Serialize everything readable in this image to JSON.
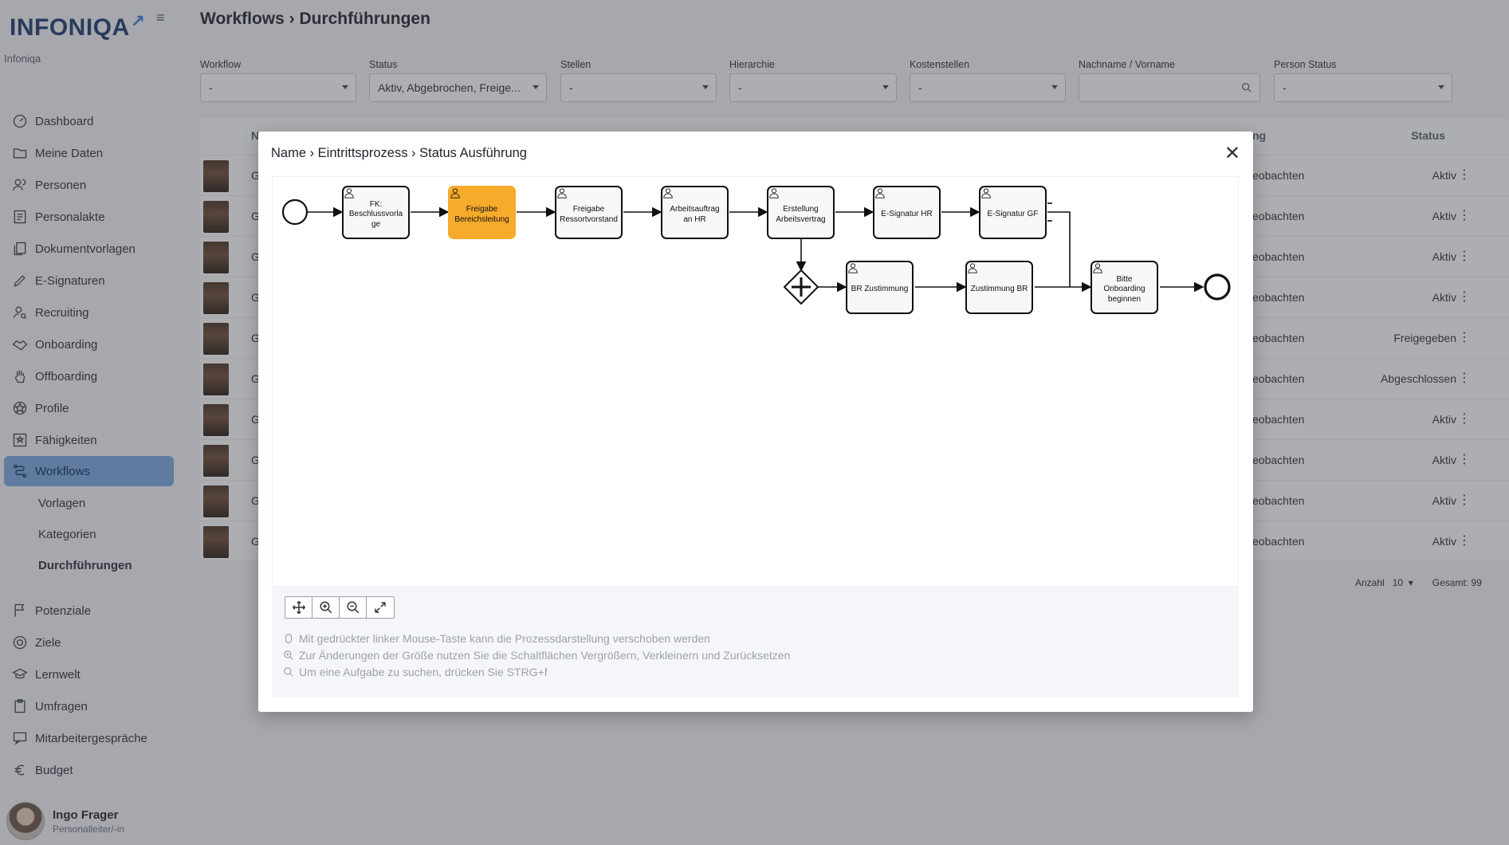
{
  "sidebar": {
    "logo": "INFONIQA",
    "tenant": "Infoniqa",
    "items": [
      {
        "label": "Dashboard",
        "icon": "gauge-icon"
      },
      {
        "label": "Meine Daten",
        "icon": "folder-icon"
      },
      {
        "label": "Personen",
        "icon": "people-icon"
      },
      {
        "label": "Personalakte",
        "icon": "file-icon"
      },
      {
        "label": "Dokumentvorlagen",
        "icon": "documents-icon"
      },
      {
        "label": "E-Signaturen",
        "icon": "pen-icon"
      },
      {
        "label": "Recruiting",
        "icon": "recruit-icon"
      },
      {
        "label": "Onboarding",
        "icon": "handshake-icon"
      },
      {
        "label": "Offboarding",
        "icon": "hand-icon"
      },
      {
        "label": "Profile",
        "icon": "profile-icon"
      },
      {
        "label": "Fähigkeiten",
        "icon": "star-box-icon"
      },
      {
        "label": "Workflows",
        "icon": "workflow-icon"
      }
    ],
    "sub_items": [
      "Vorlagen",
      "Kategorien",
      "Durchführungen"
    ],
    "items2": [
      {
        "label": "Potenziale",
        "icon": "flag-icon"
      },
      {
        "label": "Ziele",
        "icon": "target-icon"
      },
      {
        "label": "Lernwelt",
        "icon": "graduation-icon"
      },
      {
        "label": "Umfragen",
        "icon": "clipboard-icon"
      },
      {
        "label": "Mitarbeitergespräche",
        "icon": "chat-icon"
      },
      {
        "label": "Budget",
        "icon": "euro-icon"
      }
    ],
    "user": {
      "name": "Ingo Frager",
      "role": "Personalleiter/-in"
    }
  },
  "header": {
    "title": "Workflows › Durchführungen"
  },
  "filters": [
    {
      "label": "Workflow",
      "value": "-"
    },
    {
      "label": "Status",
      "value": "Aktiv, Abgebrochen, Freige..."
    },
    {
      "label": "Stellen",
      "value": "-"
    },
    {
      "label": "Hierarchie",
      "value": "-"
    },
    {
      "label": "Kostenstellen",
      "value": "-"
    },
    {
      "label": "Nachname / Vorname",
      "value": ""
    },
    {
      "label": "Person Status",
      "value": "-"
    }
  ],
  "table": {
    "header_partial_name": "N",
    "header_partial_col": "ng",
    "header_status": "Status",
    "rows": [
      {
        "name_partial": "G",
        "action": "eobachten",
        "status": "Aktiv"
      },
      {
        "name_partial": "G",
        "action": "eobachten",
        "status": "Aktiv"
      },
      {
        "name_partial": "G",
        "action": "eobachten",
        "status": "Aktiv"
      },
      {
        "name_partial": "G",
        "action": "eobachten",
        "status": "Aktiv"
      },
      {
        "name_partial": "G",
        "action": "eobachten",
        "status": "Freigegeben"
      },
      {
        "name_partial": "G",
        "action": "eobachten",
        "status": "Abgeschlossen"
      },
      {
        "name_partial": "G",
        "action": "eobachten",
        "status": "Aktiv"
      },
      {
        "name_partial": "G",
        "action": "eobachten",
        "status": "Aktiv"
      },
      {
        "name_partial": "G",
        "action": "eobachten",
        "status": "Aktiv"
      },
      {
        "name_partial": "G",
        "action": "eobachten",
        "status": "Aktiv"
      }
    ],
    "pager": {
      "count_label": "Anzahl",
      "count_value": "10",
      "total": "Gesamt: 99"
    }
  },
  "modal": {
    "title": "Name › Eintrittsprozess › Status Ausführung",
    "close": "✕",
    "tasks": [
      {
        "label": "FK: Beschlussvorla ge"
      },
      {
        "label": "Freigabe Bereichsleitung"
      },
      {
        "label": "Freigabe Ressortvorstand"
      },
      {
        "label": "Arbeitsauftrag an HR"
      },
      {
        "label": "Erstellung Arbeitsvertrag"
      },
      {
        "label": "E-Signatur HR"
      },
      {
        "label": "E-Signatur GF"
      },
      {
        "label": "BR Zustimmung"
      },
      {
        "label": "Zustimmung BR"
      },
      {
        "label": "Bitte Onboarding beginnen"
      }
    ],
    "hints": [
      "Mit gedrückter linker Mouse-Taste kann die Prozessdarstellung verschoben werden",
      "Zur Änderungen der Größe nutzen Sie die Schaltflächen Vergrößern, Verkleinern und Zurücksetzen",
      "Um eine Aufgabe zu suchen, drücken Sie STRG+f"
    ]
  },
  "colors": {
    "accent": "#7aa7e2",
    "active_task": "#f7ab2b"
  }
}
